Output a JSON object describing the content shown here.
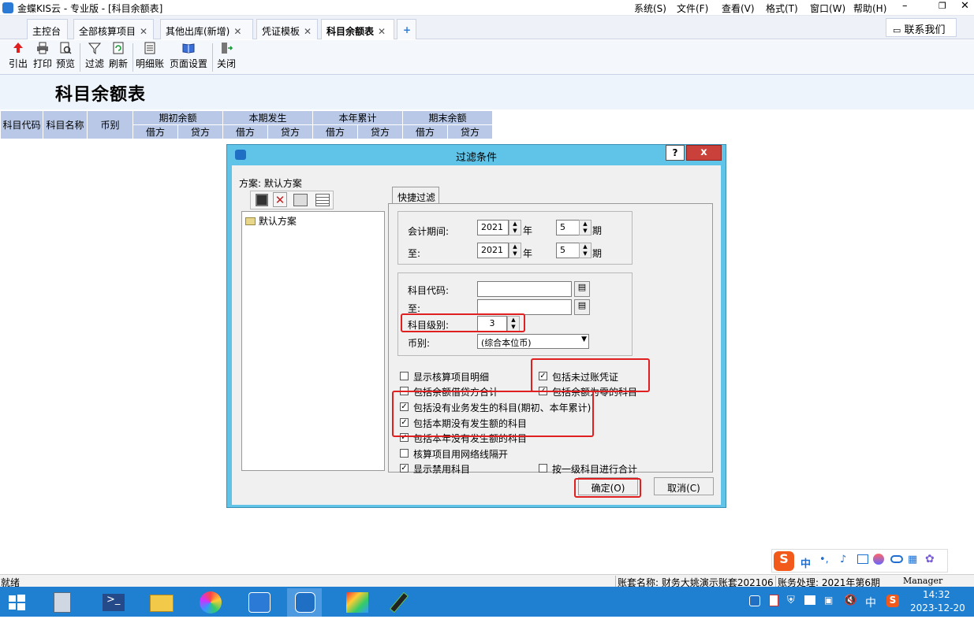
{
  "window": {
    "title": "金蝶KIS云 - 专业版 - [科目余额表]",
    "menu": [
      "系统(S)",
      "文件(F)",
      "查看(V)",
      "格式(T)",
      "窗口(W)",
      "帮助(H)"
    ]
  },
  "tabs": [
    {
      "label": "主控台",
      "closable": false
    },
    {
      "label": "全部核算项目",
      "closable": true
    },
    {
      "label": "其他出库(新增)",
      "closable": true
    },
    {
      "label": "凭证模板",
      "closable": true
    },
    {
      "label": "科目余额表",
      "closable": true,
      "active": true
    }
  ],
  "contact_button": "联系我们",
  "toolbar": [
    "引出",
    "打印",
    "预览",
    "过滤",
    "刷新",
    "明细账",
    "页面设置",
    "关闭"
  ],
  "report": {
    "title": "科目余额表",
    "columns": [
      "科目代码",
      "科目名称",
      "币别"
    ],
    "groups": [
      "期初余额",
      "本期发生",
      "本年累计",
      "期末余额"
    ],
    "subcolumns": [
      "借方",
      "贷方"
    ]
  },
  "dialog": {
    "title": "过滤条件",
    "help": "?",
    "scheme_label": "方案: 默认方案",
    "scheme_tree_item": "默认方案",
    "tab": "快捷过滤",
    "period": {
      "label_from": "会计期间:",
      "label_to": "至:",
      "year_from": "2021",
      "year_to": "2021",
      "year_unit": "年",
      "period_from": "5",
      "period_to": "5",
      "period_unit": "期"
    },
    "account": {
      "code_label": "科目代码:",
      "to_label": "至:",
      "level_label": "科目级别:",
      "level_value": "3",
      "currency_label": "币别:",
      "currency_value": "(综合本位币)"
    },
    "options": [
      {
        "label": "显示核算项目明细",
        "checked": false
      },
      {
        "label": "包括未过账凭证",
        "checked": true
      },
      {
        "label": "包括余额借贷方合计",
        "checked": false
      },
      {
        "label": "包括余额为零的科目",
        "checked": true
      },
      {
        "label": "包括没有业务发生的科目(期初、本年累计)",
        "checked": true
      },
      {
        "label": "包括本期没有发生额的科目",
        "checked": true
      },
      {
        "label": "包括本年没有发生额的科目",
        "checked": true
      },
      {
        "label": "核算项目用网络线隔开",
        "checked": false
      },
      {
        "label": "显示禁用科目",
        "checked": true
      },
      {
        "label": "按一级科目进行合计",
        "checked": false
      }
    ],
    "ok_button": "确定(O)",
    "cancel_button": "取消(C)"
  },
  "statusbar": {
    "left": "就绪",
    "account": "账套名称: 财务大姚演示账套202106",
    "period": "账务处理: 2021年第6期",
    "user": "Manager"
  },
  "ime": {
    "lang": "中"
  },
  "taskbar": {
    "time": "14:32",
    "date": "2023-12-20",
    "ime": "中"
  }
}
